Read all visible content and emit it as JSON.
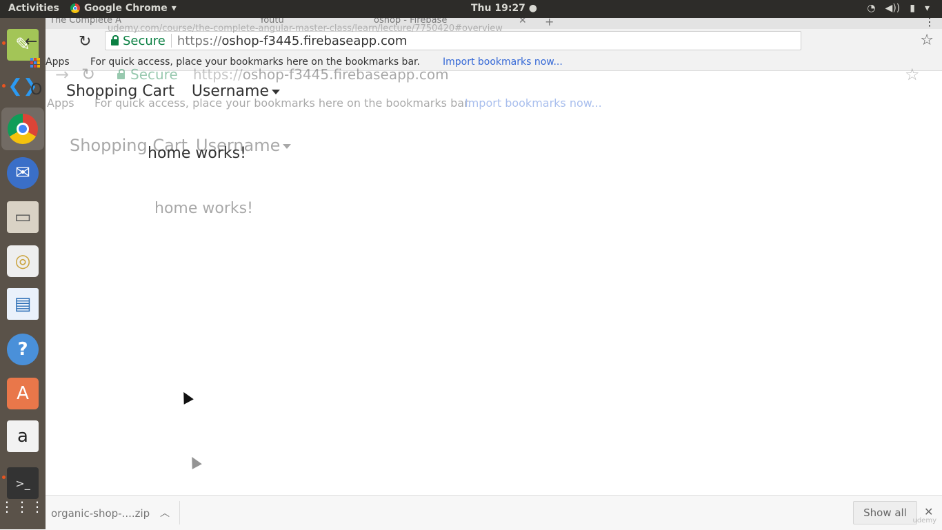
{
  "top_panel": {
    "activities": "Activities",
    "app_name": "Google Chrome",
    "clock": "Thu 19:27 ●"
  },
  "launcher": {
    "items": [
      {
        "name": "gedit-icon"
      },
      {
        "name": "vscode-icon"
      },
      {
        "name": "chrome-icon"
      },
      {
        "name": "thunderbird-icon"
      },
      {
        "name": "files-icon"
      },
      {
        "name": "rhythmbox-icon"
      },
      {
        "name": "writer-icon"
      },
      {
        "name": "help-icon"
      },
      {
        "name": "software-icon"
      },
      {
        "name": "amazon-icon"
      },
      {
        "name": "terminal-icon"
      },
      {
        "name": "show-apps-icon"
      }
    ]
  },
  "browser": {
    "ghost_tabs": [
      "The Complete A",
      "Youtu",
      "oshop - Firebase",
      "oshop - Firebase"
    ],
    "secure_label": "Secure",
    "url_scheme": "https://",
    "url_host": "oshop-f3445.firebaseapp.com",
    "ghost_url": "udemy.com/course/the-complete-angular-master-class/learn/lecture/7750420#overview",
    "bookmarks": {
      "apps": "Apps",
      "hint": "For quick access, place your bookmarks here on the bookmarks bar.",
      "import": "Import bookmarks now..."
    }
  },
  "page": {
    "brand_letter": "O",
    "nav_shopping_cart": "Shopping Cart",
    "nav_username": "Username",
    "home_text": "home works!"
  },
  "download_bar": {
    "file": "organic-shop-....zip",
    "show_all": "Show all"
  },
  "watermark": "udemy"
}
